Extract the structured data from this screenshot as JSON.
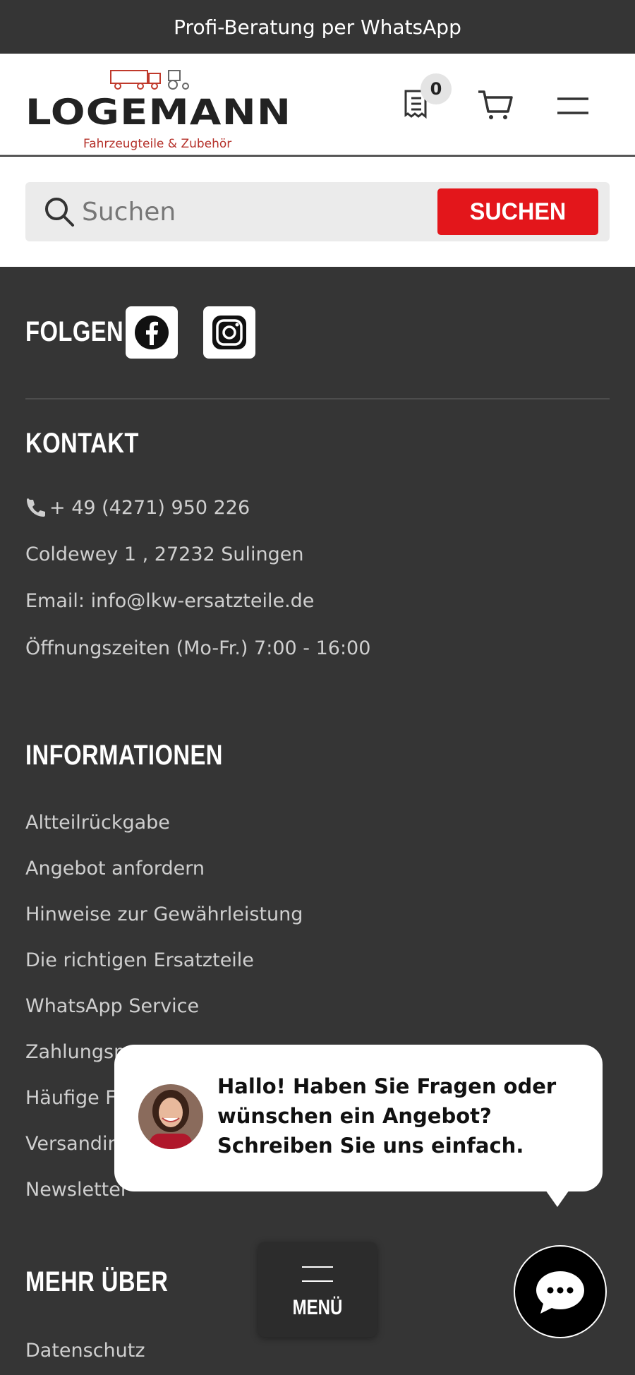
{
  "topbar": {
    "text": "Profi-Beratung per WhatsApp"
  },
  "header": {
    "logo_word": "LOGEMANN",
    "logo_sub": "Fahrzeugteile & Zubehör",
    "wishlist_count": "0"
  },
  "search": {
    "placeholder": "Suchen",
    "button_label": "SUCHEN"
  },
  "follow": {
    "heading": "FOLGEN",
    "icons": [
      "facebook-icon",
      "instagram-icon"
    ]
  },
  "contact": {
    "heading": "KONTAKT",
    "phone": "+ 49 (4271) 950 226",
    "address": "Coldewey 1 , 27232 Sulingen",
    "email": "Email: info@lkw-ersatzteile.de",
    "hours": "Öffnungszeiten (Mo-Fr.) 7:00 - 16:00"
  },
  "info": {
    "heading": "INFORMATIONEN",
    "links": [
      "Altteilrückgabe",
      "Angebot anfordern",
      "Hinweise zur Gewährleistung",
      "Die richtigen Ersatzteile",
      "WhatsApp Service",
      "Zahlungsm",
      "Häufige Fr",
      "Versandin",
      "Newsletter"
    ]
  },
  "more": {
    "heading": "MEHR ÜBER",
    "links": [
      "Datenschutz"
    ]
  },
  "chat": {
    "message": "Hallo! Haben Sie Fragen oder wünschen ein Angebot? Schreiben Sie uns einfach."
  },
  "menu": {
    "label": "MENÜ"
  },
  "colors": {
    "dark_bg": "#353535",
    "accent_red": "#e3161b",
    "logo_red": "#b5312a"
  }
}
